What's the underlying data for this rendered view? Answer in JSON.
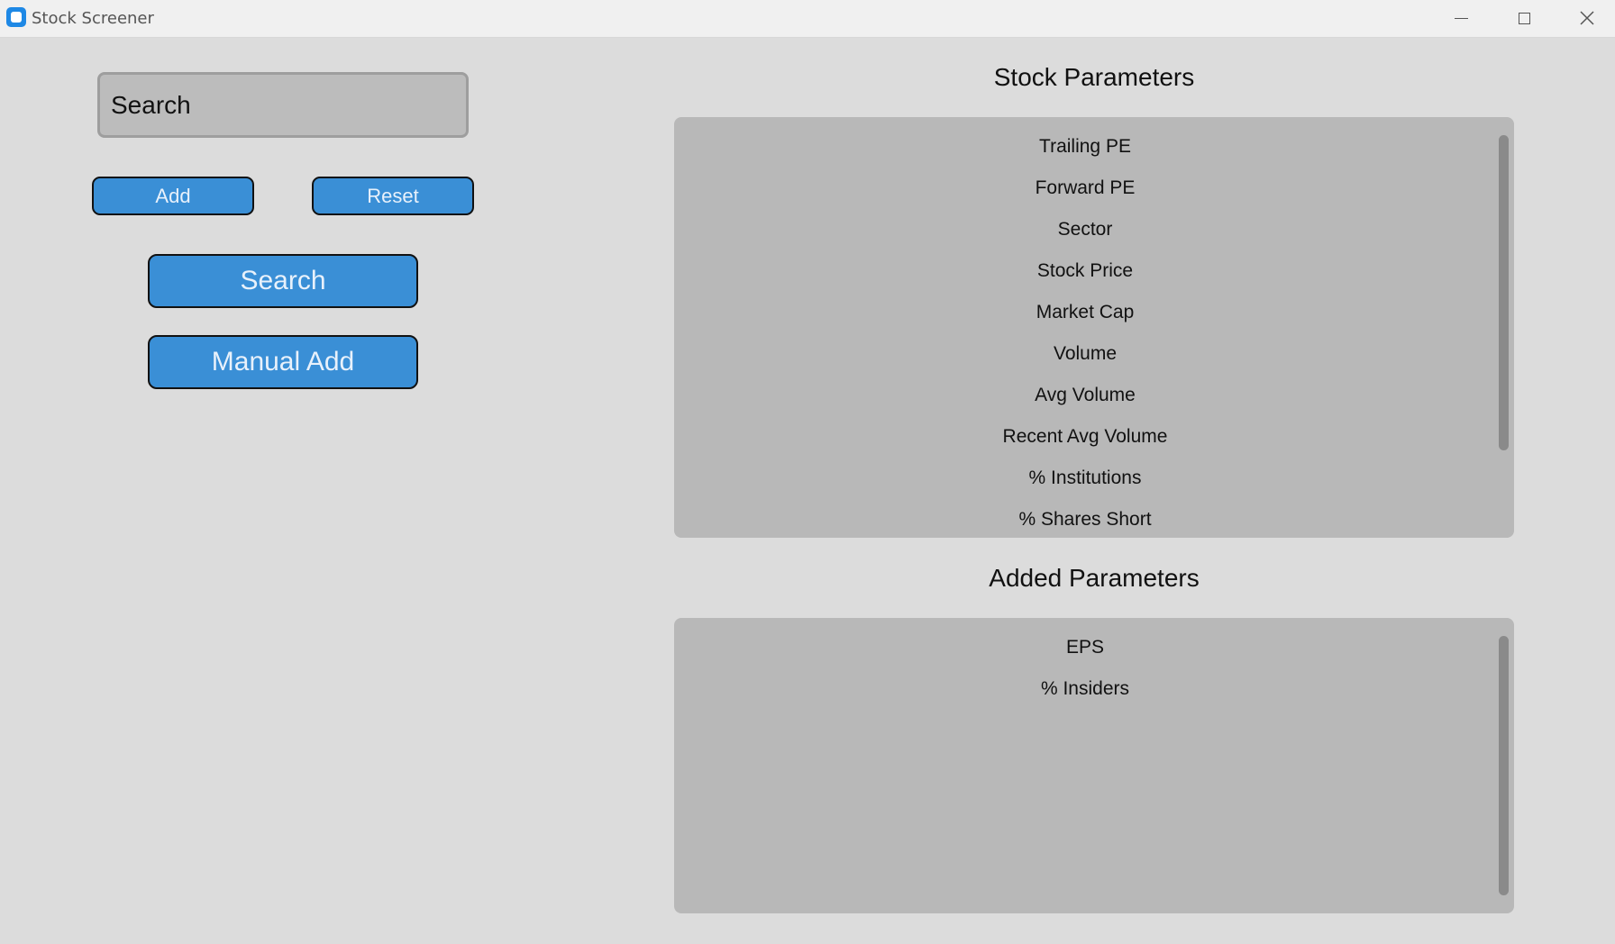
{
  "window": {
    "title": "Stock Screener",
    "icon": "app-icon"
  },
  "search": {
    "placeholder": "Search",
    "value": ""
  },
  "buttons": {
    "add": "Add",
    "reset": "Reset",
    "search": "Search",
    "manual_add": "Manual Add"
  },
  "stock_parameters": {
    "title": "Stock Parameters",
    "items": [
      "Trailing PE",
      "Forward PE",
      "Sector",
      "Stock Price",
      "Market Cap",
      "Volume",
      "Avg Volume",
      "Recent Avg Volume",
      "% Institutions",
      "% Shares Short"
    ]
  },
  "added_parameters": {
    "title": "Added Parameters",
    "items": [
      "EPS",
      "% Insiders"
    ]
  },
  "colors": {
    "button": "#3a8fd6",
    "button_text": "#e8f1fb",
    "listbox": "#b8b8b8",
    "background": "#dcdcdc"
  }
}
